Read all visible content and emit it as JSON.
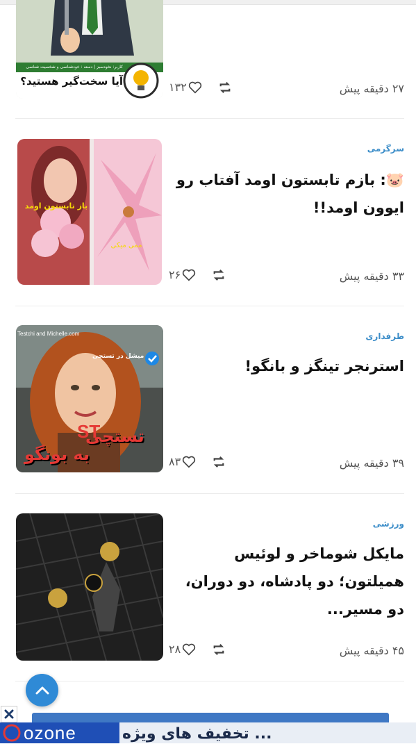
{
  "posts": [
    {
      "category": "",
      "title": "",
      "time": "۲۷ دقیقه پیش",
      "likes": "۱۳۲",
      "thumb_caption": "آیا سخت‌گیر هستید؟",
      "thumb_subcaption": "کاربر: نخودسبز | دسته : خودشناسی و شخصیت شناسی"
    },
    {
      "category": "سرگرمی",
      "title_emoji": "🐷",
      "title": ": بازم تابستون اومد آفتاب رو ایوون اومد!!",
      "time": "۳۳ دقیقه پیش",
      "likes": "۲۶",
      "thumb_caption_left": "باز تابستون اومد",
      "thumb_caption_right": "ممی میکی"
    },
    {
      "category": "طرفداری",
      "title": "استرنجر تینگز و بانگو!",
      "time": "۳۹ دقیقه پیش",
      "likes": "۸۳",
      "thumb_watermark": "Testchi and Michelle.com",
      "thumb_badge": "میشل در تستچی",
      "thumb_logo": "تستچی",
      "thumb_logo_sub": "به بونگو",
      "thumb_st": "ST"
    },
    {
      "category": "ورزشی",
      "title": "مایکل شوماخر و لوئیس همیلتون؛ دو پادشاه، دو دوران، دو مسیر...",
      "time": "۴۵ دقیقه پیش",
      "likes": "۲۸"
    }
  ],
  "ad": {
    "brand": "ozone",
    "text": "... تخفیف های ویژه"
  },
  "colors": {
    "accent": "#3d8ec9",
    "fab": "#2f8ad6",
    "divider": "#ececec"
  },
  "icons": [
    "heart-icon",
    "repost-icon",
    "chevron-up-icon",
    "close-icon"
  ]
}
